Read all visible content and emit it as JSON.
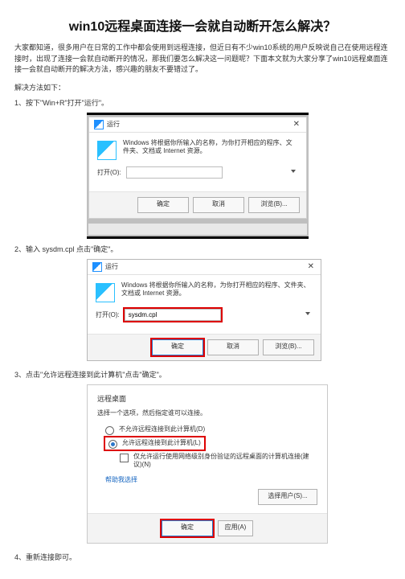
{
  "title": "win10远程桌面连接一会就自动断开怎么解决？",
  "intro": "大家都知道，很多用户在日常的工作中都会使用到远程连接，但近日有不少win10系统的用户反映说自己在使用远程连接时，出现了连接一会就自动断开的情况，那我们要怎么解决这一问题呢？下面本文就为大家分享了win10远程桌面连接一会就自动断开的解决方法，感兴趣的朋友不要错过了。",
  "pre_steps": "解决方法如下：",
  "steps": {
    "s1": "1、按下\"Win+R\"打开\"运行\"。",
    "s2": "2、输入 sysdm.cpl 点击\"确定\"。",
    "s3": "3、点击\"允许远程连接到此计算机\"点击\"确定\"。",
    "s4": "4、重新连接即可。"
  },
  "run": {
    "title": "运行",
    "desc": "Windows 将根据你所输入的名称，为你打开相应的程序、文件夹、文档或 Internet 资源。",
    "open_label": "打开(O):",
    "input_value": "sysdm.cpl",
    "ok": "确定",
    "cancel": "取消",
    "browse": "浏览(B)..."
  },
  "remote": {
    "section": "远程桌面",
    "sub": "选择一个选项，然后指定谁可以连接。",
    "opt_disallow": "不允许远程连接到此计算机(D)",
    "opt_allow": "允许远程连接到此计算机(L)",
    "check": "仅允许运行使用网络级别身份验证的远程桌面的计算机连接(建议)(N)",
    "help": "帮助我选择",
    "select_users": "选择用户(S)...",
    "ok": "确定",
    "apply": "应用(A)"
  }
}
